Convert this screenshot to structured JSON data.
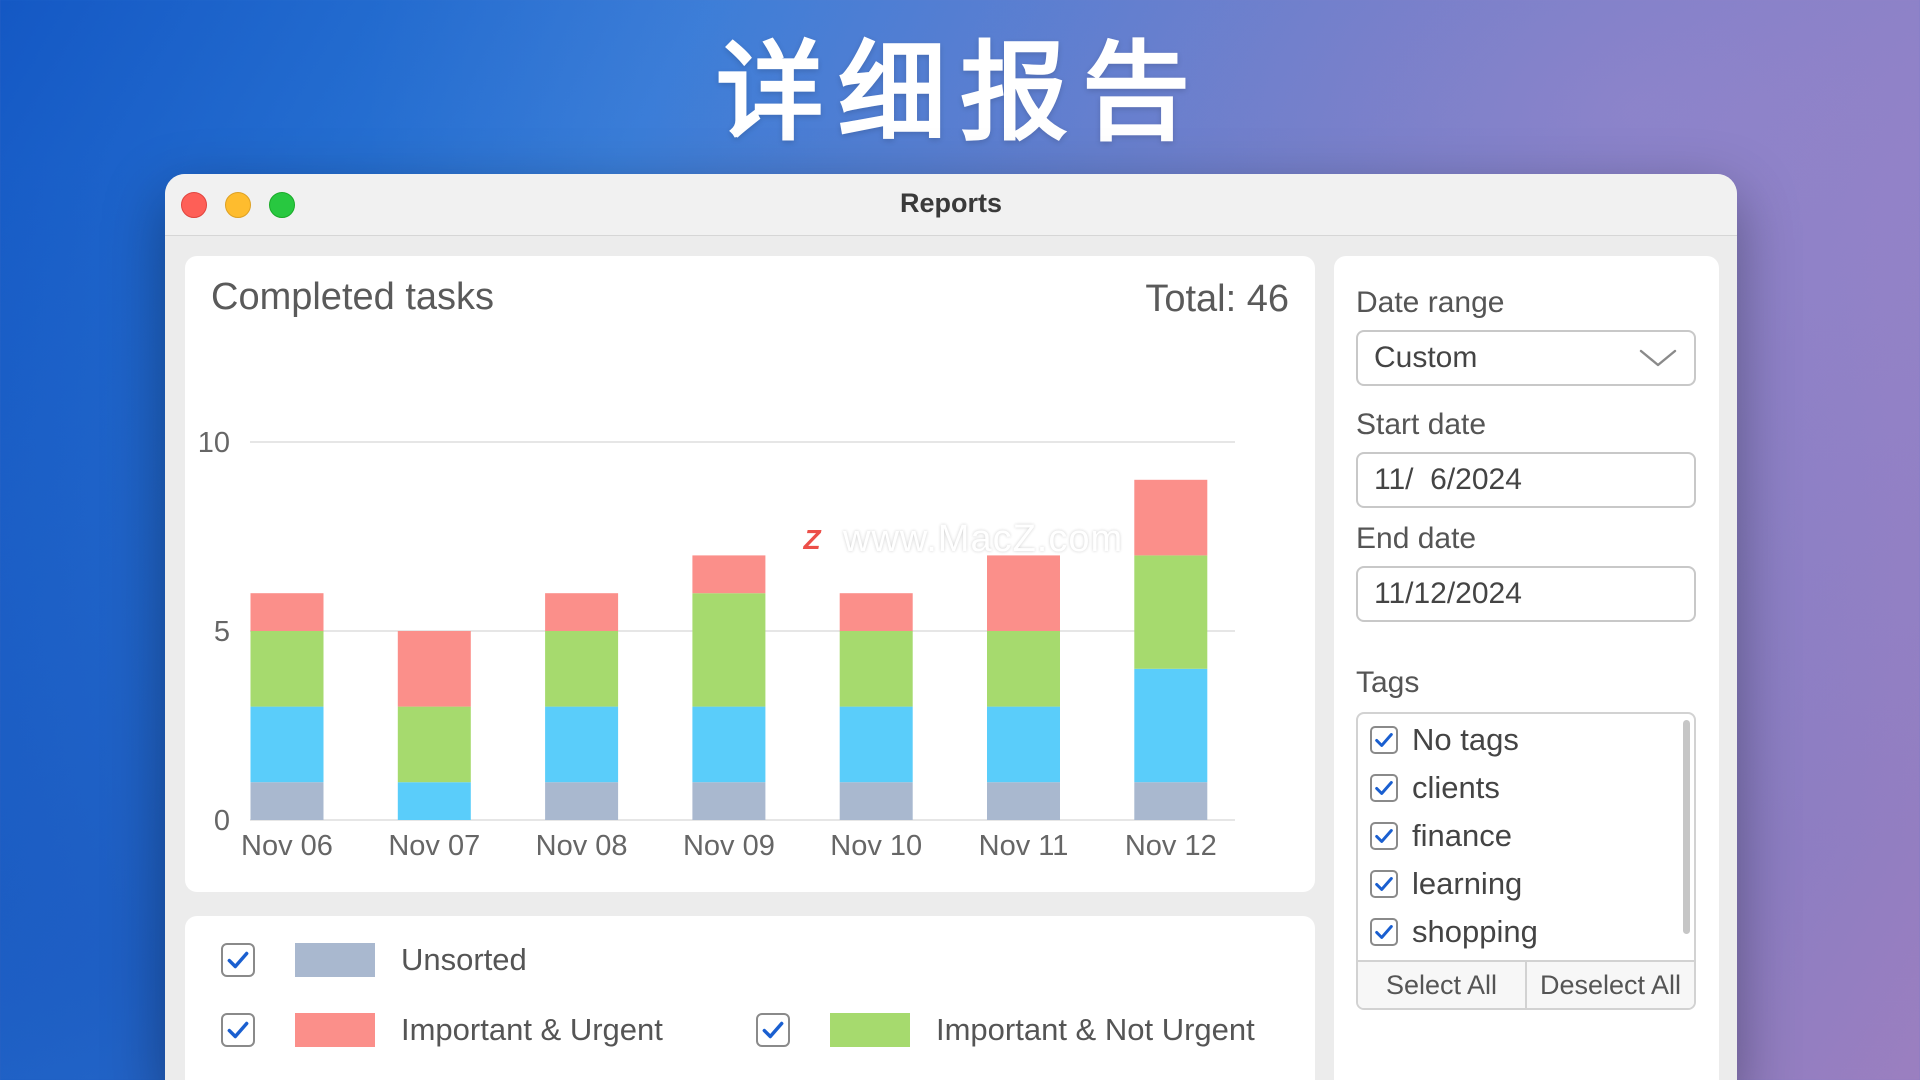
{
  "hero": {
    "title": "详细报告"
  },
  "window": {
    "title": "Reports"
  },
  "chart": {
    "title": "Completed tasks",
    "total": "Total: 46"
  },
  "chart_data": {
    "type": "bar",
    "stacked": true,
    "categories": [
      "Nov 06",
      "Nov 07",
      "Nov 08",
      "Nov 09",
      "Nov 10",
      "Nov 11",
      "Nov 12"
    ],
    "series": [
      {
        "name": "Unsorted",
        "color": "#a9b8cf",
        "values": [
          1,
          0,
          1,
          1,
          1,
          1,
          1
        ]
      },
      {
        "color": "#5acdfa",
        "values": [
          2,
          1,
          2,
          2,
          2,
          2,
          3
        ]
      },
      {
        "name": "Important & Not Urgent",
        "color": "#a6da6e",
        "values": [
          2,
          2,
          2,
          3,
          2,
          2,
          3
        ]
      },
      {
        "name": "Important & Urgent",
        "color": "#fb8f8a",
        "values": [
          1,
          2,
          1,
          1,
          1,
          2,
          2
        ]
      }
    ],
    "yticks": [
      "0",
      "5",
      "10"
    ],
    "ylim": [
      0,
      10
    ],
    "grid": true
  },
  "legend": {
    "items": [
      {
        "label": "Unsorted",
        "color": "#a9b8cf",
        "checked": true
      },
      {
        "label": "Important & Urgent",
        "color": "#fb8f8a",
        "checked": true
      },
      {
        "label": "Important & Not Urgent",
        "color": "#a6da6e",
        "checked": true
      }
    ]
  },
  "sidebar": {
    "date_range_label": "Date range",
    "date_range_value": "Custom",
    "start_date_label": "Start date",
    "start_date_value": "11/  6/2024",
    "end_date_label": "End date",
    "end_date_value": "11/12/2024",
    "tags_label": "Tags",
    "tags": [
      {
        "label": "No tags",
        "checked": true
      },
      {
        "label": "clients",
        "checked": true
      },
      {
        "label": "finance",
        "checked": true
      },
      {
        "label": "learning",
        "checked": true
      },
      {
        "label": "shopping",
        "checked": true
      }
    ],
    "select_all": "Select All",
    "deselect_all": "Deselect All"
  },
  "watermark": {
    "logo": "Z",
    "text": "www.MacZ.com"
  },
  "colors": {
    "check": "#1a5fd0"
  }
}
